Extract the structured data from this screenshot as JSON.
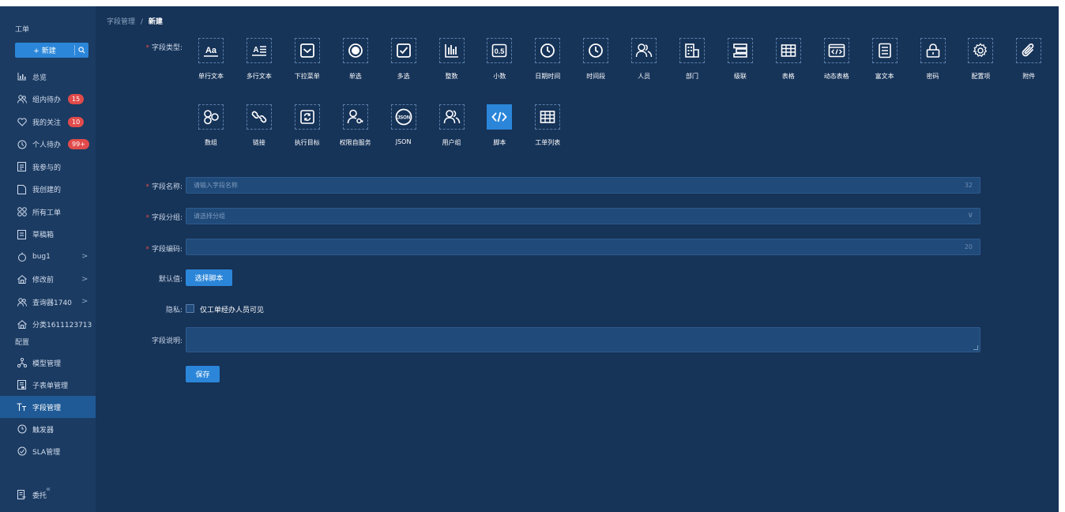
{
  "sidebar": {
    "title": "工单",
    "new_label": "+ 新建",
    "items": [
      {
        "label": "总览",
        "icon": "chart-bar-icon"
      },
      {
        "label": "组内待办",
        "icon": "users-icon",
        "badge": "15"
      },
      {
        "label": "我的关注",
        "icon": "heart-icon",
        "badge": "10"
      },
      {
        "label": "个人待办",
        "icon": "clock-icon",
        "badge": "99+"
      },
      {
        "label": "我参与的",
        "icon": "doc-icon"
      },
      {
        "label": "我创建的",
        "icon": "file-icon"
      },
      {
        "label": "所有工单",
        "icon": "grid-icon"
      },
      {
        "label": "草稿箱",
        "icon": "draft-icon"
      },
      {
        "label": "bug1",
        "icon": "drop-icon",
        "arrow": ">"
      },
      {
        "label": "修改前",
        "icon": "home-icon",
        "arrow": ">"
      },
      {
        "label": "查询器1740",
        "icon": "users-icon",
        "arrow": ">"
      },
      {
        "label": "分类1611123713",
        "icon": "home-icon"
      }
    ],
    "config_section": "配置",
    "config_items": [
      {
        "label": "模型管理",
        "icon": "model-icon"
      },
      {
        "label": "子表单管理",
        "icon": "subform-icon"
      },
      {
        "label": "字段管理",
        "icon": "text-type-icon",
        "active": true
      },
      {
        "label": "触发器",
        "icon": "trigger-icon"
      },
      {
        "label": "SLA管理",
        "icon": "sla-icon"
      }
    ],
    "bottom_items": [
      {
        "label": "委托",
        "icon": "delegate-icon"
      }
    ],
    "collapse_label": "«"
  },
  "breadcrumb": {
    "parent": "字段管理",
    "separator": "/",
    "current": "新建"
  },
  "form": {
    "field_type_label": "字段类型:",
    "field_types_row1": [
      {
        "label": "单行文本",
        "icon": "single-line-text-icon"
      },
      {
        "label": "多行文本",
        "icon": "multi-line-text-icon"
      },
      {
        "label": "下拉菜单",
        "icon": "dropdown-icon"
      },
      {
        "label": "单选",
        "icon": "radio-icon"
      },
      {
        "label": "多选",
        "icon": "checkbox-icon"
      },
      {
        "label": "整数",
        "icon": "integer-icon"
      },
      {
        "label": "小数",
        "icon": "decimal-icon"
      },
      {
        "label": "日期时间",
        "icon": "datetime-icon"
      },
      {
        "label": "时间段",
        "icon": "time-range-icon"
      },
      {
        "label": "人员",
        "icon": "person-icon"
      },
      {
        "label": "部门",
        "icon": "department-icon"
      },
      {
        "label": "级联",
        "icon": "cascade-icon"
      },
      {
        "label": "表格",
        "icon": "table-icon"
      },
      {
        "label": "动态表格",
        "icon": "dynamic-table-icon"
      },
      {
        "label": "富文本",
        "icon": "rich-text-icon"
      },
      {
        "label": "密码",
        "icon": "password-icon"
      },
      {
        "label": "配置项",
        "icon": "config-item-icon"
      },
      {
        "label": "附件",
        "icon": "attachment-icon"
      }
    ],
    "field_types_row2": [
      {
        "label": "数组",
        "icon": "array-icon"
      },
      {
        "label": "链接",
        "icon": "link-icon"
      },
      {
        "label": "执行目标",
        "icon": "exec-target-icon"
      },
      {
        "label": "权限自服务",
        "icon": "permission-icon"
      },
      {
        "label": "JSON",
        "icon": "json-icon"
      },
      {
        "label": "用户组",
        "icon": "user-group-icon"
      },
      {
        "label": "脚本",
        "icon": "script-icon",
        "active": true
      },
      {
        "label": "工单列表",
        "icon": "ticket-list-icon"
      }
    ],
    "name_label": "字段名称:",
    "name_placeholder": "请输入字段名称",
    "name_count": "32",
    "group_label": "字段分组:",
    "group_placeholder": "请选择分组",
    "group_chevron": "∨",
    "code_label": "字段编码:",
    "code_count": "20",
    "default_label": "默认值:",
    "select_script_label": "选择脚本",
    "privacy_label": "隐私:",
    "privacy_option": "仅工单经办人员可见",
    "desc_label": "字段说明:",
    "save_label": "保存"
  }
}
